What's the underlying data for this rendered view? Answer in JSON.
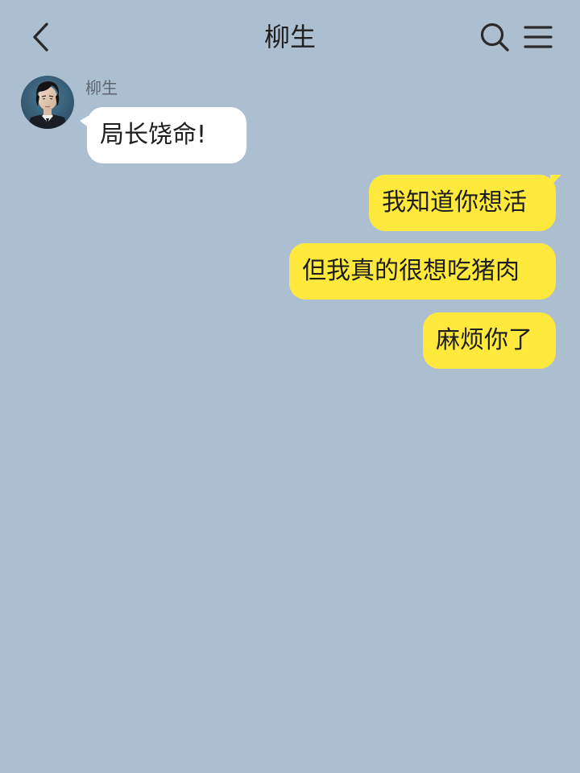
{
  "header": {
    "title": "柳生",
    "back_icon": "chevron-left-icon",
    "search_icon": "search-icon",
    "menu_icon": "hamburger-menu-icon"
  },
  "messages": [
    {
      "direction": "incoming",
      "sender": "柳生",
      "text": "局长饶命!"
    },
    {
      "direction": "outgoing",
      "text": "我知道你想活"
    },
    {
      "direction": "outgoing",
      "text": "但我真的很想吃猪肉"
    },
    {
      "direction": "outgoing",
      "text": "麻烦你了"
    }
  ],
  "colors": {
    "background": "#abbfd1",
    "incoming_bubble": "#ffffff",
    "outgoing_bubble": "#ffe93c",
    "text": "#1e1e1e"
  }
}
